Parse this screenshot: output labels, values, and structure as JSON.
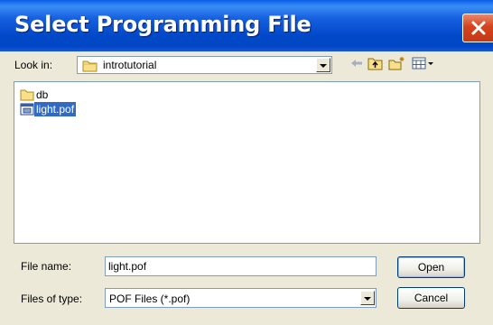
{
  "dialog": {
    "title": "Select Programming File"
  },
  "lookin": {
    "label": "Look in:",
    "value": "introtutorial"
  },
  "toolbar": {
    "back_icon": "back-arrow-icon",
    "up_icon": "up-folder-icon",
    "new_folder_icon": "new-folder-icon",
    "views_icon": "views-menu-icon"
  },
  "files": [
    {
      "name": "db",
      "type": "folder",
      "selected": false
    },
    {
      "name": "light.pof",
      "type": "pof",
      "selected": true
    }
  ],
  "filename": {
    "label": "File name:",
    "value": "light.pof"
  },
  "filetype": {
    "label": "Files of type:",
    "value": "POF Files (*.pof)"
  },
  "buttons": {
    "open": "Open",
    "cancel": "Cancel"
  },
  "colors": {
    "title_bar": "#0a5ee8",
    "selection": "#316ac5",
    "close_button": "#d5431c"
  }
}
